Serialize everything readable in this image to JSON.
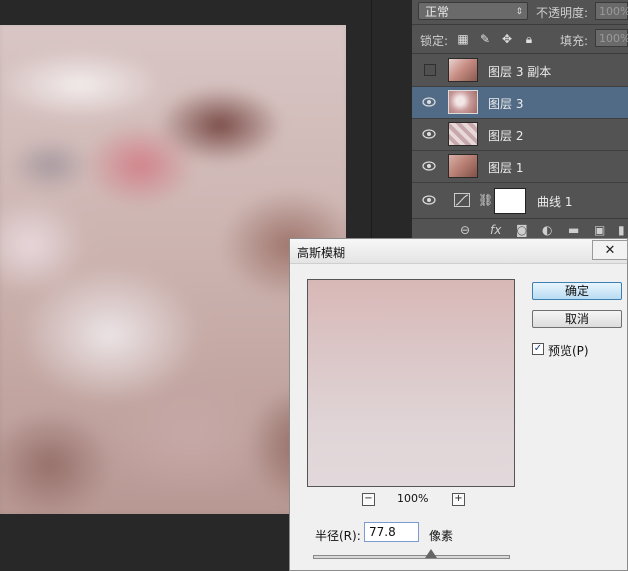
{
  "layers_panel": {
    "blend_mode": "正常",
    "opacity_label": "不透明度:",
    "opacity_value": "100%",
    "lock_label": "锁定:",
    "fill_label": "填充:",
    "fill_value": "100%",
    "layers": [
      {
        "name": "图层 3 副本",
        "visible": false,
        "selected": false
      },
      {
        "name": "图层 3",
        "visible": true,
        "selected": true
      },
      {
        "name": "图层 2",
        "visible": true,
        "selected": false
      },
      {
        "name": "图层 1",
        "visible": true,
        "selected": false
      }
    ],
    "adjustment_layer": {
      "name": "曲线 1",
      "visible": true
    }
  },
  "dialog": {
    "title": "高斯模糊",
    "close_glyph": "✕",
    "ok_label": "确定",
    "cancel_label": "取消",
    "preview_label": "预览(P)",
    "preview_checked": true,
    "zoom_out": "−",
    "zoom_in": "+",
    "zoom_value": "100%",
    "radius_label": "半径(R):",
    "radius_value": "77.8",
    "radius_unit": "像素",
    "slider_level": 0.6
  }
}
